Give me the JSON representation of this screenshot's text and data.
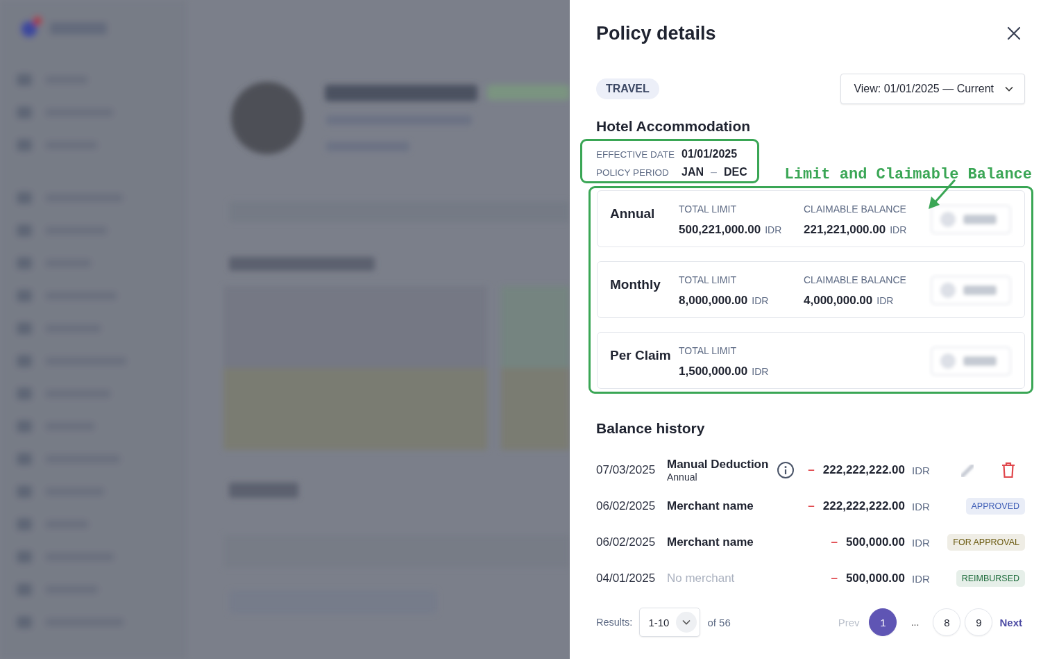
{
  "panel": {
    "title": "Policy details"
  },
  "category_tag": "TRAVEL",
  "view_select": {
    "value": "View: 01/01/2025 — Current"
  },
  "policy": {
    "name": "Hotel Accommodation",
    "effective_date": {
      "label": "EFFECTIVE DATE",
      "value": "01/01/2025"
    },
    "policy_period": {
      "label": "POLICY PERIOD",
      "start": "JAN",
      "separator": "–",
      "end": "DEC"
    }
  },
  "annotation": {
    "text": "Limit and Claimable Balance"
  },
  "limits": [
    {
      "period": "Annual",
      "fields": [
        {
          "label": "TOTAL LIMIT",
          "amount": "500,221,000.00",
          "currency": "IDR"
        },
        {
          "label": "CLAIMABLE BALANCE",
          "amount": "221,221,000.00",
          "currency": "IDR"
        }
      ]
    },
    {
      "period": "Monthly",
      "fields": [
        {
          "label": "TOTAL LIMIT",
          "amount": "8,000,000.00",
          "currency": "IDR"
        },
        {
          "label": "CLAIMABLE BALANCE",
          "amount": "4,000,000.00",
          "currency": "IDR"
        }
      ]
    },
    {
      "period": "Per Claim",
      "fields": [
        {
          "label": "TOTAL LIMIT",
          "amount": "1,500,000.00",
          "currency": "IDR"
        }
      ]
    }
  ],
  "balance_history": {
    "title": "Balance history",
    "rows": [
      {
        "kind": "manual",
        "date": "07/03/2025",
        "title": "Manual Deduction",
        "subtitle": "Annual",
        "sign": "–",
        "amount": "222,222,222.00",
        "currency": "IDR"
      },
      {
        "kind": "status",
        "date": "06/02/2025",
        "title": "Merchant name",
        "muted": false,
        "sign": "–",
        "amount": "222,222,222.00",
        "currency": "IDR",
        "status": "APPROVED",
        "color": "#3b5bb5"
      },
      {
        "kind": "status",
        "date": "06/02/2025",
        "title": "Merchant name",
        "muted": false,
        "sign": "–",
        "amount": "500,000.00",
        "currency": "IDR",
        "status": "FOR APPROVAL",
        "color": "#6b5a10"
      },
      {
        "kind": "status",
        "date": "04/01/2025",
        "title": "No merchant",
        "muted": true,
        "sign": "–",
        "amount": "500,000.00",
        "currency": "IDR",
        "status": "REIMBURSED",
        "color": "#1c6b3a"
      }
    ]
  },
  "pagination": {
    "results_label": "Results:",
    "page_size": "1-10",
    "total": "of 56",
    "prev": {
      "label": "Prev",
      "disabled": true
    },
    "pages": [
      {
        "kind": "page",
        "label": "1",
        "selected": true
      },
      {
        "kind": "ellipsis",
        "label": "..."
      },
      {
        "kind": "page",
        "label": "8",
        "selected": false
      },
      {
        "kind": "page",
        "label": "9",
        "selected": false
      }
    ],
    "next": {
      "label": "Next",
      "disabled": false
    }
  }
}
